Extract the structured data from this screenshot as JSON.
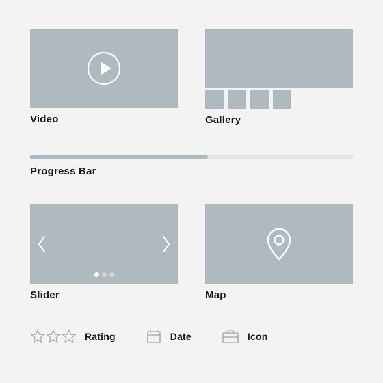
{
  "video": {
    "label": "Video"
  },
  "gallery": {
    "label": "Gallery",
    "thumb_count": 4
  },
  "progress": {
    "label": "Progress Bar",
    "percent": 55
  },
  "slider": {
    "label": "Slider",
    "dot_count": 3,
    "active_dot": 0
  },
  "map": {
    "label": "Map"
  },
  "rating": {
    "label": "Rating",
    "stars": 3
  },
  "date": {
    "label": "Date"
  },
  "icon": {
    "label": "Icon"
  }
}
